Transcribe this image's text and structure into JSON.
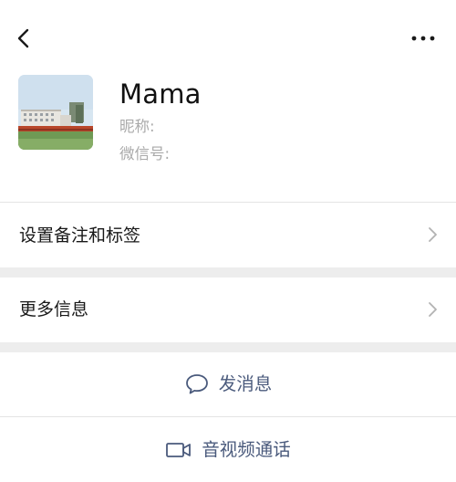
{
  "header": {
    "back_icon": "chevron-left-icon",
    "more_icon": "more-dots-icon"
  },
  "profile": {
    "name": "Mama",
    "nickname_label": "昵称:",
    "wechat_id_label": "微信号:"
  },
  "menu": {
    "remark_tags": "设置备注和标签",
    "more_info": "更多信息"
  },
  "actions": {
    "send_message": "发消息",
    "video_call": "音视频通话"
  },
  "colors": {
    "action_text": "#4a5a7c",
    "background": "#ededed",
    "row_background": "#ffffff"
  }
}
